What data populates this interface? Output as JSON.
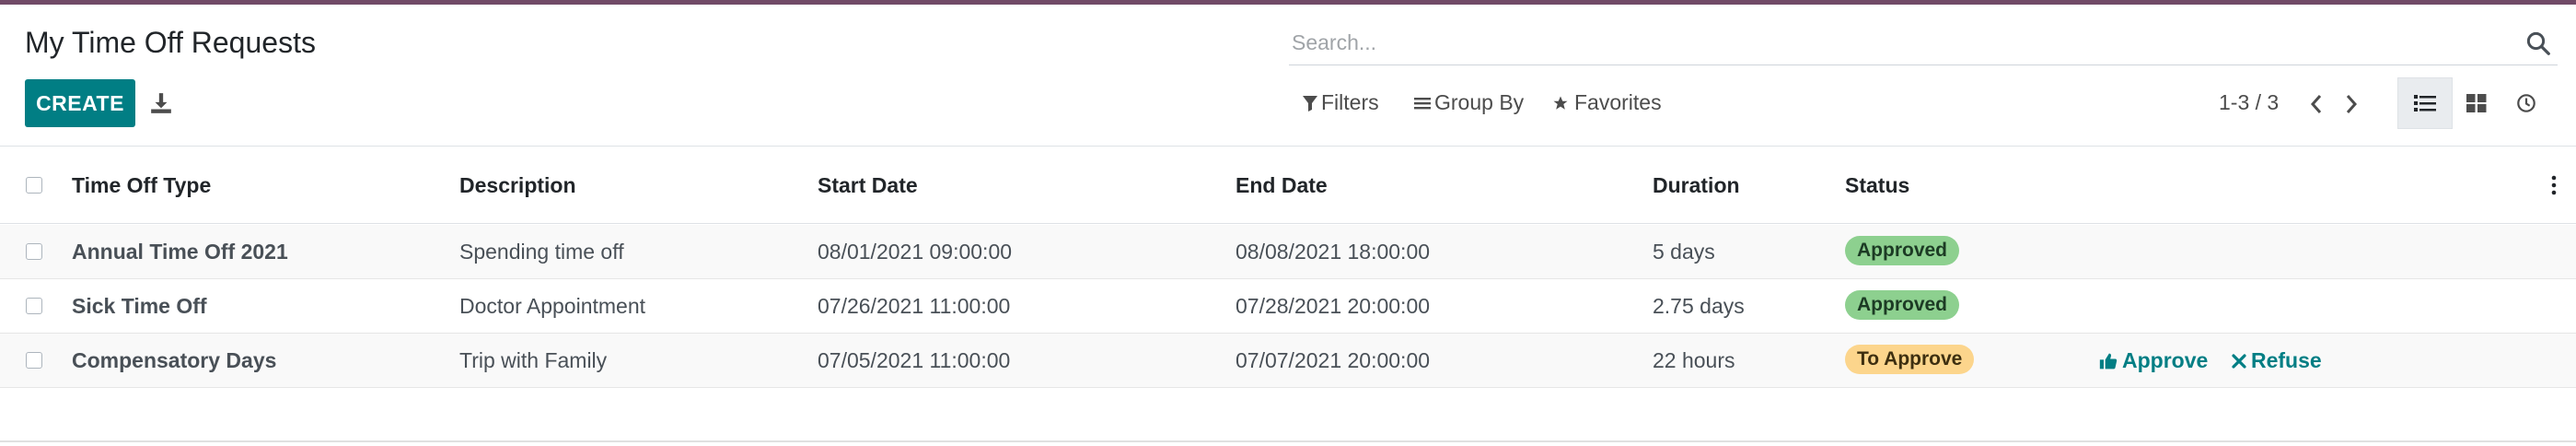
{
  "page": {
    "title": "My Time Off Requests"
  },
  "search": {
    "placeholder": "Search..."
  },
  "toolbar": {
    "create_label": "CREATE"
  },
  "filters": {
    "filters_label": "Filters",
    "groupby_label": "Group By",
    "favorites_label": "Favorites"
  },
  "pager": {
    "text": "1-3 / 3"
  },
  "columns": {
    "type": "Time Off Type",
    "description": "Description",
    "start": "Start Date",
    "end": "End Date",
    "duration": "Duration",
    "status": "Status"
  },
  "rows": [
    {
      "type": "Annual Time Off 2021",
      "description": "Spending time off",
      "start": "08/01/2021 09:00:00",
      "end": "08/08/2021 18:00:00",
      "duration": "5 days",
      "status": "Approved"
    },
    {
      "type": "Sick Time Off",
      "description": "Doctor Appointment",
      "start": "07/26/2021 11:00:00",
      "end": "07/28/2021 20:00:00",
      "duration": "2.75 days",
      "status": "Approved"
    },
    {
      "type": "Compensatory Days",
      "description": "Trip with Family",
      "start": "07/05/2021 11:00:00",
      "end": "07/07/2021 20:00:00",
      "duration": "22 hours",
      "status": "To Approve",
      "approve_label": "Approve",
      "refuse_label": "Refuse"
    }
  ],
  "colors": {
    "brand_bar": "#714b67",
    "primary": "#017e84",
    "approved": "#8dd08f",
    "to_approve": "#fcd58c"
  }
}
